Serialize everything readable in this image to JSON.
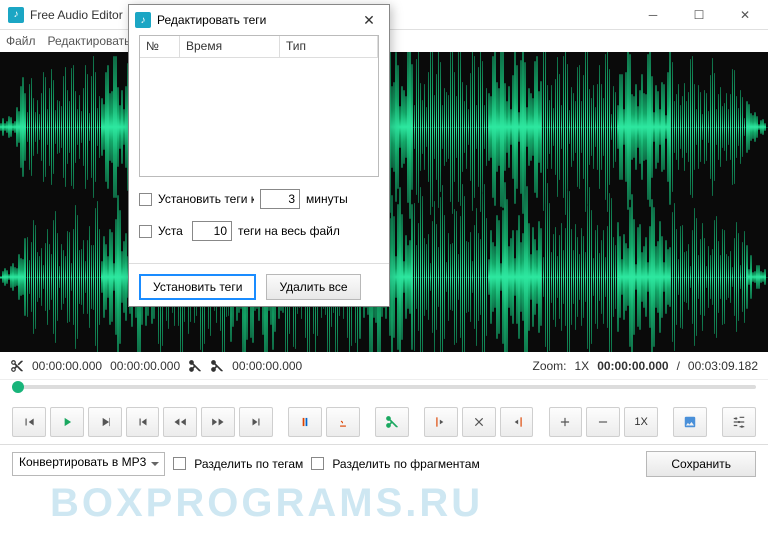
{
  "app": {
    "title": "Free Audio Editor"
  },
  "menu": {
    "file": "Файл",
    "edit": "Редактировать"
  },
  "time": {
    "t1": "00:00:00.000",
    "t2": "00:00:00.000",
    "t3": "00:00:00.000",
    "zoom_label": "Zoom:",
    "zoom_value": "1X",
    "pos": "00:00:00.000",
    "sep": "/",
    "dur": "00:03:09.182"
  },
  "toolbar": {
    "zoom_text": "1X"
  },
  "bottom": {
    "convert": "Конвертировать в MP3",
    "split_tags": "Разделить по тегам",
    "split_frag": "Разделить по фрагментам",
    "save": "Сохранить"
  },
  "dialog": {
    "title": "Редактировать теги",
    "col_no": "№",
    "col_time": "Время",
    "col_type": "Тип",
    "row1_label": "Установить теги к",
    "row1_value": "3",
    "row1_unit": "минуты",
    "row2_label": "Уста",
    "row2_value": "10",
    "row2_rest": "теги на весь файл",
    "btn_set": "Установить теги",
    "btn_del": "Удалить все"
  },
  "watermark": "BOXPROGRAMS.RU"
}
